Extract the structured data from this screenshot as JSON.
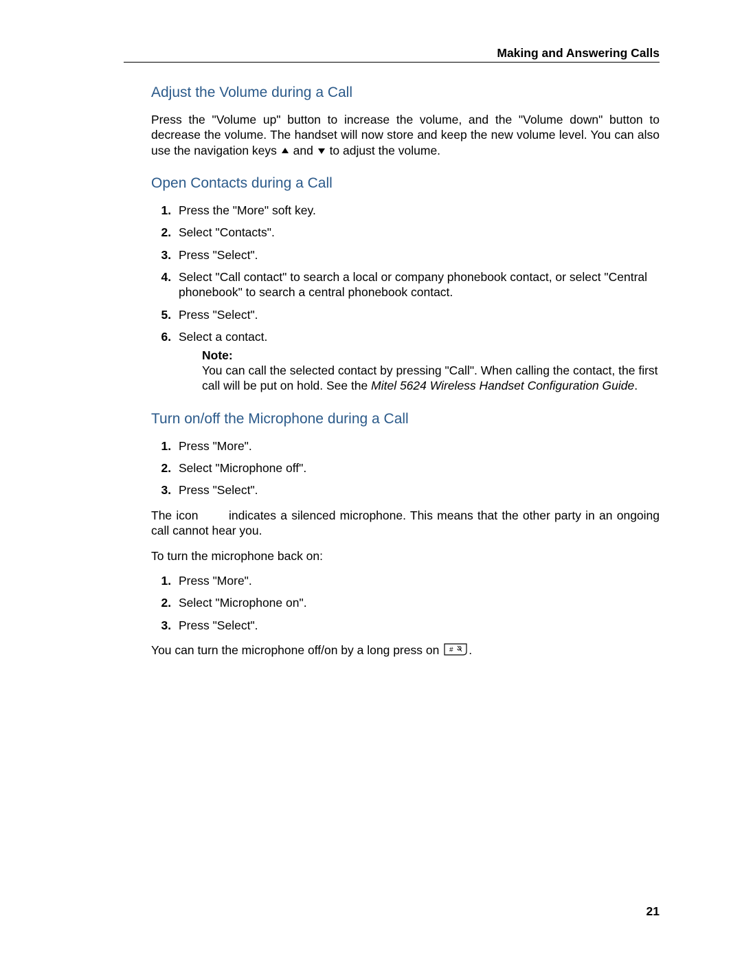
{
  "header": {
    "running_head": "Making and Answering Calls",
    "page_number": "21"
  },
  "sections": {
    "volume": {
      "title": "Adjust the Volume during a Call",
      "para_pre": "Press the \"Volume up\" button to increase the volume, and the \"Volume down\" button to decrease the volume. The handset will now store and keep the new volume level. You can also use the navigation keys ",
      "para_mid": " and ",
      "para_post": " to adjust the volume."
    },
    "contacts": {
      "title": "Open Contacts during a Call",
      "steps": [
        "Press the \"More\" soft key.",
        "Select \"Contacts\".",
        "Press \"Select\".",
        "Select \"Call contact\" to search a local or company phonebook contact, or select \"Central phonebook\" to search a central phonebook contact.",
        "Press \"Select\".",
        "Select a contact."
      ],
      "note_label": "Note:",
      "note_text": "You can call the selected contact by pressing \"Call\". When calling the contact, the first call will be put on hold. See the ",
      "note_ref": "Mitel 5624 Wireless Handset Configuration Guide",
      "note_after": "."
    },
    "mic": {
      "title": "Turn on/off the Microphone during a Call",
      "steps_off": [
        "Press \"More\".",
        "Select \"Microphone off\".",
        "Press \"Select\"."
      ],
      "icon_para_pre": "The icon ",
      "icon_para_post": " indicates a silenced microphone. This means that the other party in an ongoing call cannot hear you.",
      "back_on_intro": "To turn the microphone back on:",
      "steps_on": [
        "Press \"More\".",
        "Select \"Microphone on\".",
        "Press \"Select\"."
      ],
      "longpress_pre": "You can turn the microphone off/on by a long press on ",
      "longpress_post": "."
    }
  }
}
